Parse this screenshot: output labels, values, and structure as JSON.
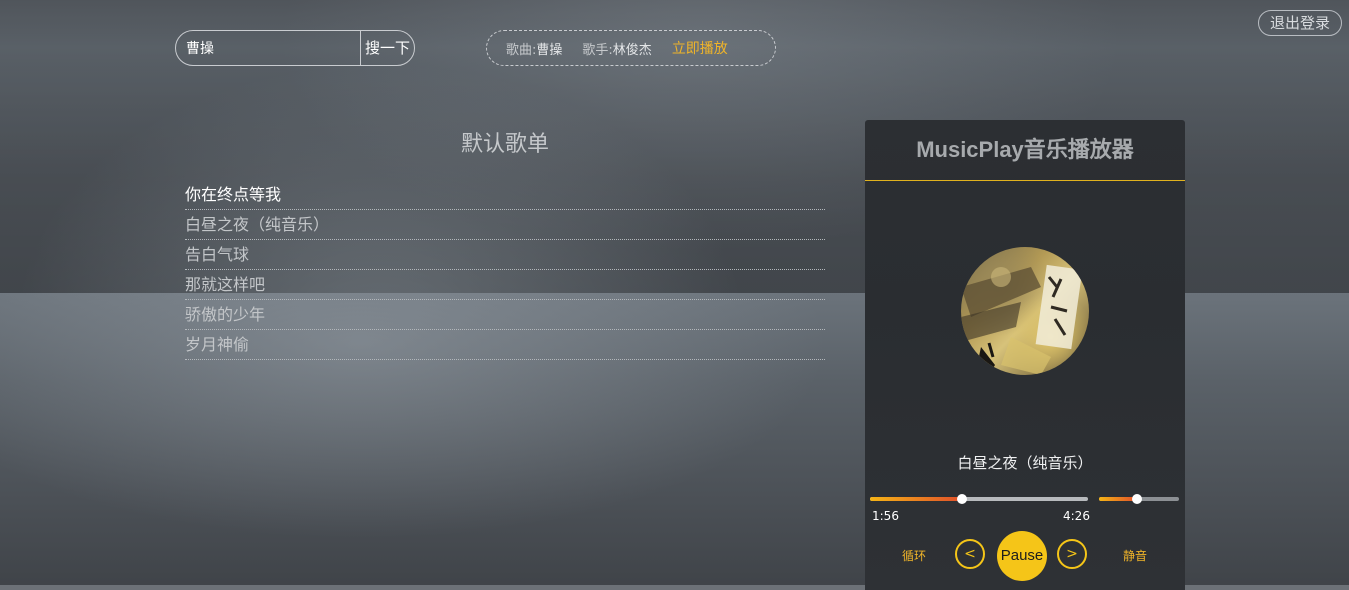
{
  "header": {
    "logout_label": "退出登录"
  },
  "search": {
    "value": "曹操",
    "button_label": "搜一下"
  },
  "now_info": {
    "song_label": "歌曲:",
    "song_value": "曹操",
    "singer_label": "歌手:",
    "singer_value": "林俊杰",
    "play_now_label": "立即播放"
  },
  "playlist": {
    "title": "默认歌单",
    "items": [
      {
        "label": "你在终点等我"
      },
      {
        "label": "白昼之夜（纯音乐）"
      },
      {
        "label": "告白气球"
      },
      {
        "label": "那就这样吧"
      },
      {
        "label": "骄傲的少年"
      },
      {
        "label": "岁月神偷"
      }
    ],
    "active_index": 0
  },
  "player": {
    "title": "MusicPlay音乐播放器",
    "song_name": "白昼之夜（纯音乐）",
    "current_time": "1:56",
    "total_time": "4:26",
    "progress_fraction": 0.42,
    "volume_fraction": 0.48,
    "loop_label": "循环",
    "prev_label": "<",
    "pause_label": "Pause",
    "next_label": ">",
    "mute_label": "静音"
  },
  "colors": {
    "accent": "#f5c518",
    "accent_text": "#f0b429",
    "progress_start": "#f5b416",
    "progress_end": "#e0502a"
  },
  "icons": {
    "cover": "album-cover-image"
  }
}
